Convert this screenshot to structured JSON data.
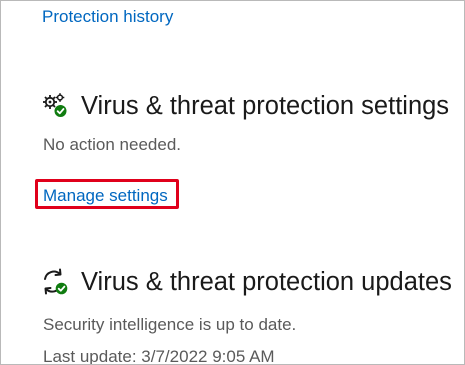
{
  "links": {
    "protection_history": "Protection history",
    "manage_settings": "Manage settings"
  },
  "settings_section": {
    "title": "Virus & threat protection settings",
    "status": "No action needed.",
    "icon": "gear-check-icon"
  },
  "updates_section": {
    "title": "Virus & threat protection updates",
    "status": "Security intelligence is up to date.",
    "last_update": "Last update: 3/7/2022 9:05 AM",
    "icon": "refresh-check-icon"
  },
  "colors": {
    "link": "#0067c0",
    "highlight": "#e0001b",
    "check": "#107c10"
  }
}
